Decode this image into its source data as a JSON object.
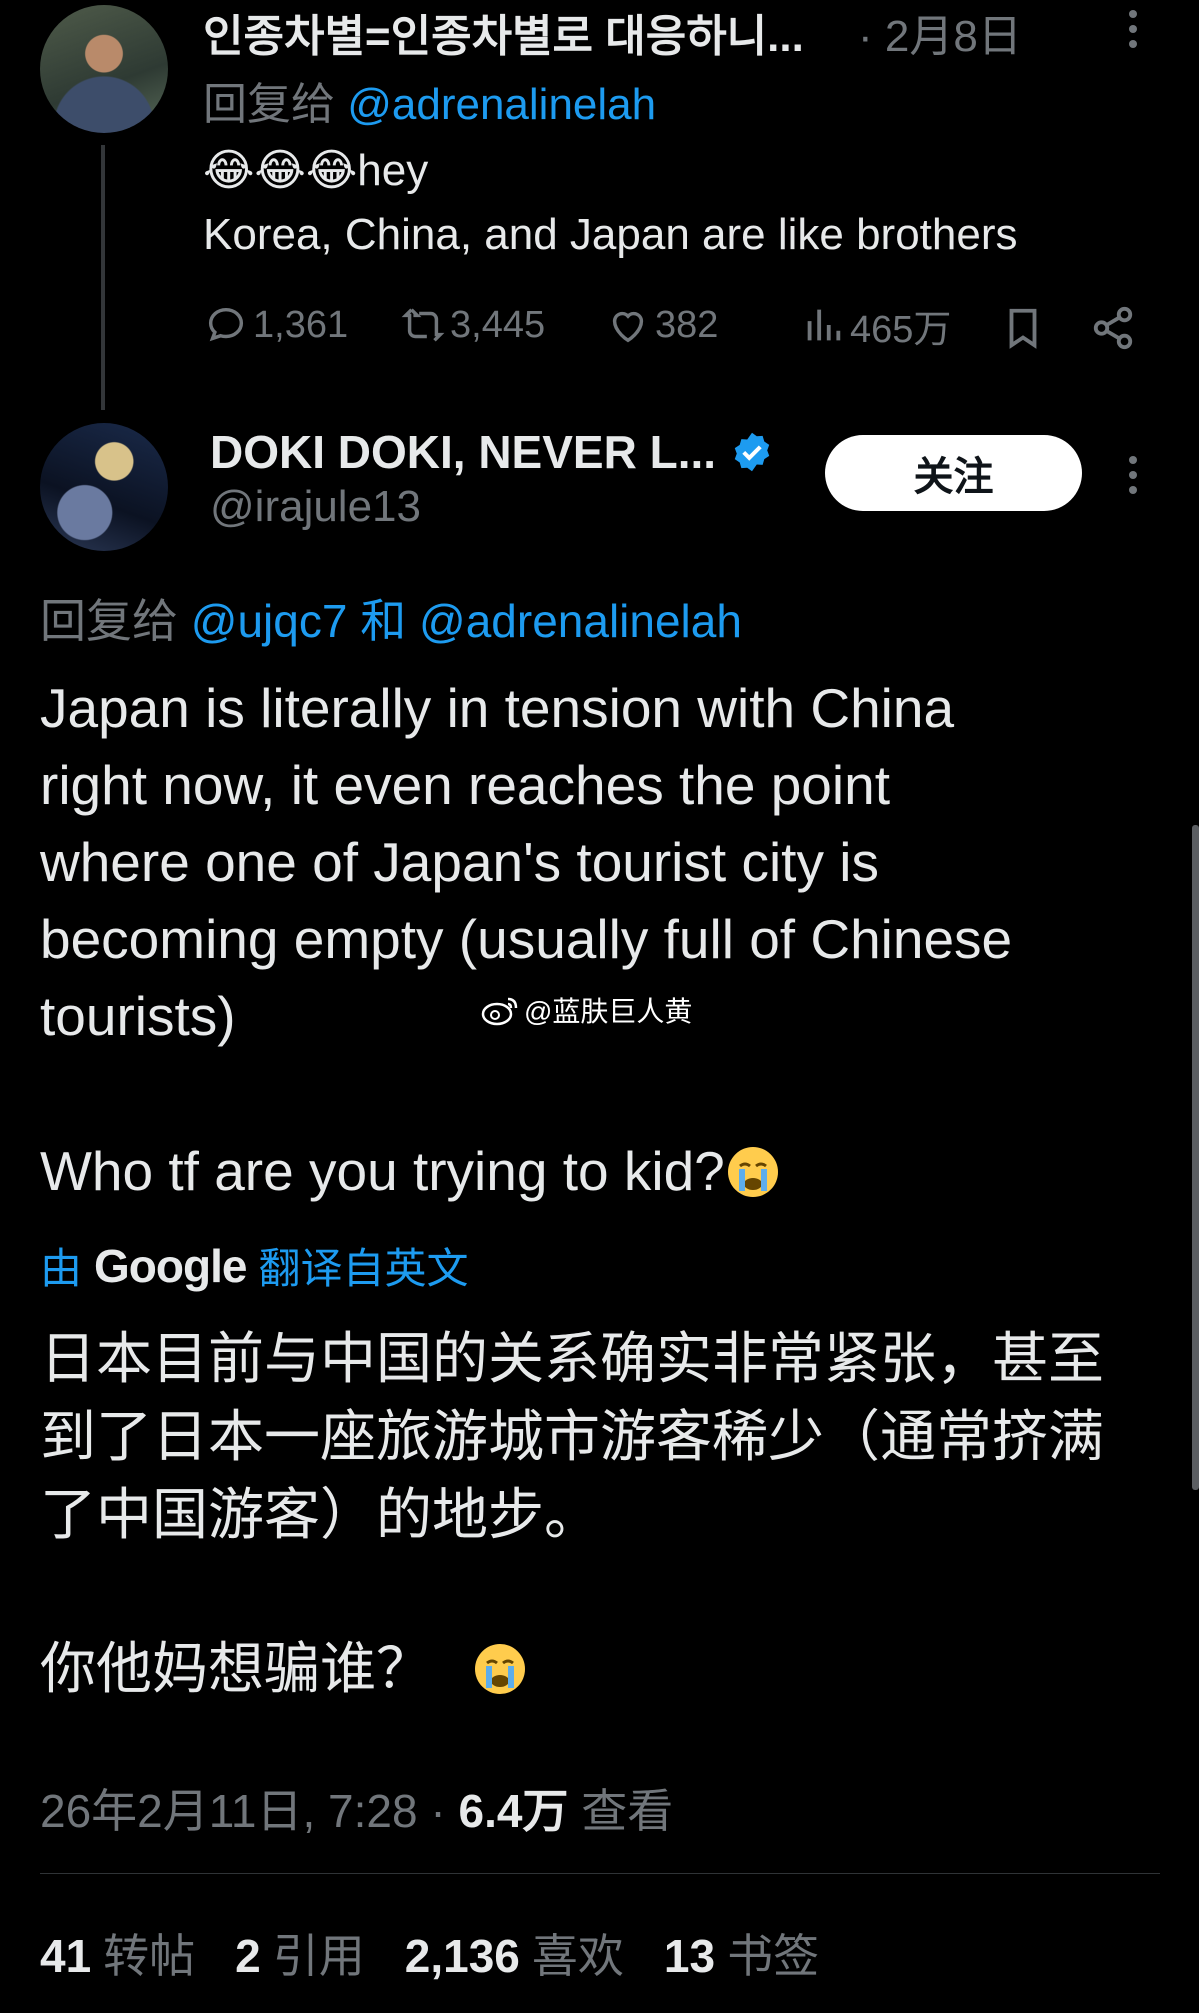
{
  "reply_tweet": {
    "author_name": "인종차별=인종차별로 대응하니...",
    "date": "· 2月8日",
    "reply_label": "回复给",
    "reply_to": "@adrenalinelah",
    "text_line1_emojis": "😂😂😂",
    "text_line1": "hey",
    "text_line2": "Korea, China, and Japan are like brothers",
    "actions": {
      "replies": "1,361",
      "retweets": "3,445",
      "likes": "382",
      "views": "465万"
    }
  },
  "main_tweet": {
    "author_name": "DOKI DOKI, NEVER L...",
    "handle": "@irajule13",
    "follow_label": "关注",
    "reply_label": "回复给",
    "reply_to_1": "@ujqc7",
    "reply_and": "和",
    "reply_to_2": "@adrenalinelah",
    "text_en": [
      "Japan is literally in tension with China",
      "right now, it even reaches the point",
      "where one of Japan's tourist city is",
      "becoming empty (usually full of Chinese",
      "tourists)",
      "Who tf are you trying to kid?"
    ],
    "translation": {
      "by": "由",
      "provider": "Google",
      "from": "翻译自英文"
    },
    "text_zh": [
      "日本目前与中国的关系确实非常紧张，甚至",
      "到了日本一座旅游城市游客稀少（通常挤满",
      "了中国游客）的地步。",
      "你他妈想骗谁？"
    ],
    "timestamp": "26年2月11日, 7:28 · ",
    "views_count": "6.4万",
    "views_label": " 查看",
    "stats": [
      {
        "count": "41",
        "label": "转帖"
      },
      {
        "count": "2",
        "label": "引用"
      },
      {
        "count": "2,136",
        "label": "喜欢"
      },
      {
        "count": "13",
        "label": "书签"
      }
    ]
  },
  "watermark": "@蓝肤巨人黄",
  "colors": {
    "background": "#000000",
    "text": "#e7e9ea",
    "secondary": "#71767b",
    "link": "#1d9bf0",
    "verified": "#1d9bf0"
  }
}
